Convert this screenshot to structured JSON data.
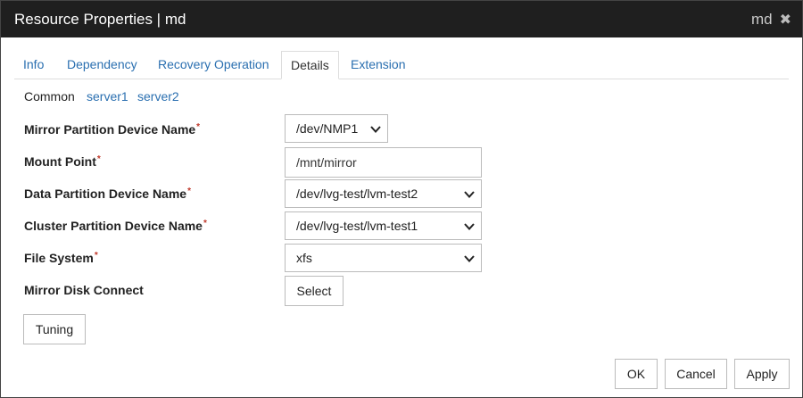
{
  "window": {
    "title": "Resource Properties | md",
    "user": "md",
    "close_glyph": "✖"
  },
  "tabs": [
    {
      "label": "Info",
      "active": false
    },
    {
      "label": "Dependency",
      "active": false
    },
    {
      "label": "Recovery Operation",
      "active": false
    },
    {
      "label": "Details",
      "active": true
    },
    {
      "label": "Extension",
      "active": false
    }
  ],
  "subtabs": [
    {
      "label": "Common",
      "active": true
    },
    {
      "label": "server1",
      "active": false
    },
    {
      "label": "server2",
      "active": false
    }
  ],
  "form": {
    "mirror_partition_device_name": {
      "label": "Mirror Partition Device Name",
      "value": "/dev/NMP1"
    },
    "mount_point": {
      "label": "Mount Point",
      "value": "/mnt/mirror"
    },
    "data_partition_device_name": {
      "label": "Data Partition Device Name",
      "value": "/dev/lvg-test/lvm-test2"
    },
    "cluster_partition_device_name": {
      "label": "Cluster Partition Device Name",
      "value": "/dev/lvg-test/lvm-test1"
    },
    "file_system": {
      "label": "File System",
      "value": "xfs"
    },
    "mirror_disk_connect": {
      "label": "Mirror Disk Connect",
      "button": "Select"
    },
    "required_mark": "*"
  },
  "buttons": {
    "tuning": "Tuning",
    "ok": "OK",
    "cancel": "Cancel",
    "apply": "Apply"
  },
  "colors": {
    "titlebar": "#1f1f1f",
    "link": "#2a6fb0",
    "required": "#c0392b"
  },
  "icons": {
    "dropdown": "chevron-down-icon",
    "close": "close-icon"
  }
}
